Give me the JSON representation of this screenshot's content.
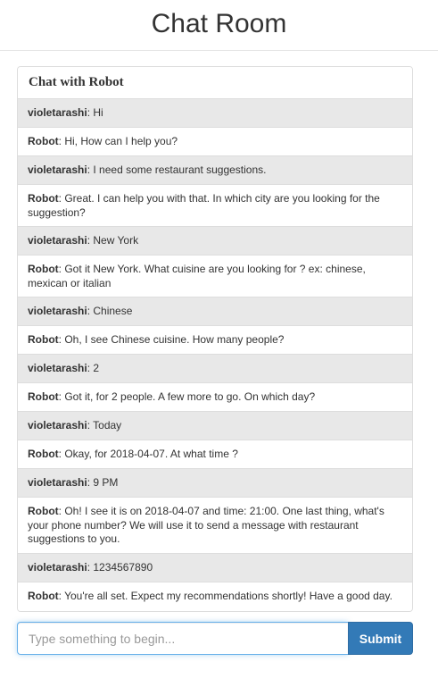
{
  "header": {
    "title": "Chat Room"
  },
  "panel": {
    "title": "Chat with Robot"
  },
  "messages": [
    {
      "sender": "violetarashi",
      "role": "user",
      "text": "Hi"
    },
    {
      "sender": "Robot",
      "role": "bot",
      "text": "Hi, How can I help you?"
    },
    {
      "sender": "violetarashi",
      "role": "user",
      "text": "I need some restaurant suggestions."
    },
    {
      "sender": "Robot",
      "role": "bot",
      "text": "Great. I can help you with that. In which city are you looking for the suggestion?"
    },
    {
      "sender": "violetarashi",
      "role": "user",
      "text": "New York"
    },
    {
      "sender": "Robot",
      "role": "bot",
      "text": "Got it New York. What cuisine are you looking for ? ex: chinese, mexican or italian"
    },
    {
      "sender": "violetarashi",
      "role": "user",
      "text": "Chinese"
    },
    {
      "sender": "Robot",
      "role": "bot",
      "text": "Oh, I see Chinese cuisine. How many people?"
    },
    {
      "sender": "violetarashi",
      "role": "user",
      "text": "2"
    },
    {
      "sender": "Robot",
      "role": "bot",
      "text": "Got it, for 2 people. A few more to go. On which day?"
    },
    {
      "sender": "violetarashi",
      "role": "user",
      "text": "Today"
    },
    {
      "sender": "Robot",
      "role": "bot",
      "text": "Okay, for 2018-04-07. At what time ?"
    },
    {
      "sender": "violetarashi",
      "role": "user",
      "text": "9 PM"
    },
    {
      "sender": "Robot",
      "role": "bot",
      "text": "Oh! I see it is on 2018-04-07 and time: 21:00. One last thing, what's your phone number? We will use it to send a message with restaurant suggestions to you."
    },
    {
      "sender": "violetarashi",
      "role": "user",
      "text": "1234567890"
    },
    {
      "sender": "Robot",
      "role": "bot",
      "text": "You're all set. Expect my recommendations shortly! Have a good day."
    }
  ],
  "composer": {
    "placeholder": "Type something to begin...",
    "value": "",
    "submit_label": "Submit"
  },
  "colors": {
    "user_row_bg": "#e8e8e8",
    "bot_row_bg": "#ffffff",
    "button_primary": "#337ab7",
    "input_focus_border": "#66afe9"
  }
}
